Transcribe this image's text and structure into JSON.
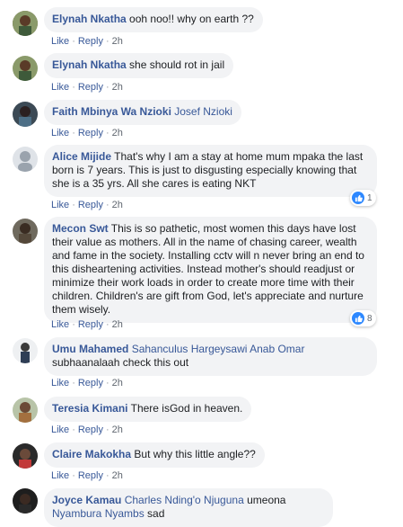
{
  "comments": [
    {
      "author": "Elynah Nkatha",
      "text": "ooh noo!! why on earth ??",
      "like": "Like",
      "reply": "Reply",
      "time": "2h"
    },
    {
      "author": "Elynah Nkatha",
      "text": "she should rot in jail",
      "like": "Like",
      "reply": "Reply",
      "time": "2h"
    },
    {
      "author": "Faith Mbinya Wa Nzioki",
      "tag": "Josef Nzioki",
      "like": "Like",
      "reply": "Reply",
      "time": "2h"
    },
    {
      "author": "Alice Mijide",
      "text": "That's why I am a stay at home mum mpaka the last born is 7 years. This is just to disgusting especially knowing that she is a 35 yrs. All she cares is eating NKT",
      "like": "Like",
      "reply": "Reply",
      "time": "2h",
      "reactions": "1"
    },
    {
      "author": "Mecon Swt",
      "text": "This is so pathetic, most women this days have lost their value as mothers. All in the name of chasing career, wealth and fame in the society. Installing cctv will n never bring an end to this disheartening activities. Instead mother's should readjust or minimize their work loads in order to create more time with their children. Children's are gift from God, let's appreciate and nurture them wisely.",
      "like": "Like",
      "reply": "Reply",
      "time": "2h",
      "reactions": "8"
    },
    {
      "author": "Umu Mahamed",
      "tag": "Sahanculus Hargeysawi Anab Omar",
      "text": "subhaanalaah check this out",
      "like": "Like",
      "reply": "Reply",
      "time": "2h"
    },
    {
      "author": "Teresia Kimani",
      "text": "There isGod in heaven.",
      "like": "Like",
      "reply": "Reply",
      "time": "2h"
    },
    {
      "author": "Claire Makokha",
      "text": "But why this little angle??",
      "like": "Like",
      "reply": "Reply",
      "time": "2h"
    },
    {
      "author": "Joyce Kamau",
      "tag": "Charles Nding'o Njuguna",
      "text": "umeona",
      "tag2": "Nyambura Nyambs",
      "text2": "sad"
    }
  ],
  "separator": "·",
  "colors": {
    "link": "#385898",
    "bubble": "#f2f3f5",
    "like_blue": "#2d88ff"
  },
  "icons": [
    "like-reaction-icon",
    "avatar"
  ]
}
